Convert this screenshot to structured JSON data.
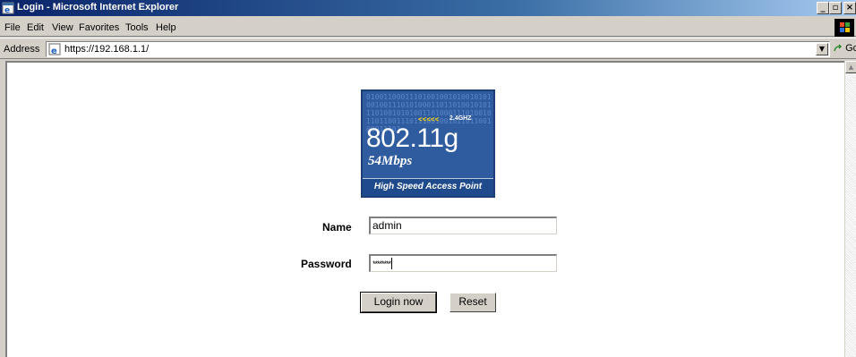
{
  "window": {
    "title": "Login - Microsoft Internet Explorer",
    "controls": {
      "minimize": "_",
      "maximize": "▫",
      "close": "×"
    }
  },
  "menu": {
    "items": [
      {
        "label": "File"
      },
      {
        "label": "Edit"
      },
      {
        "label": "View"
      },
      {
        "label": "Favorites"
      },
      {
        "label": "Tools"
      },
      {
        "label": "Help"
      }
    ]
  },
  "address_bar": {
    "label": "Address",
    "url": "https://192.168.1.1/",
    "go_label": "Go"
  },
  "logo": {
    "bits": "0100110001110100100101001010100100111010100011011010010101110100101010011010001110100101101100111011100100101101100100011101",
    "arrows": "<<<<<",
    "band": "2.4GHZ",
    "standard": "802.11g",
    "speed": "54Mbps",
    "tagline": "High Speed Access Point"
  },
  "form": {
    "name_label": "Name",
    "name_value": "admin",
    "password_label": "Password",
    "password_mask": "********",
    "login_button": "Login now",
    "reset_button": "Reset"
  },
  "colors": {
    "titlebar_start": "#0a246a",
    "logo_bg": "#2f5c9f",
    "chrome": "#d4d0c8"
  }
}
